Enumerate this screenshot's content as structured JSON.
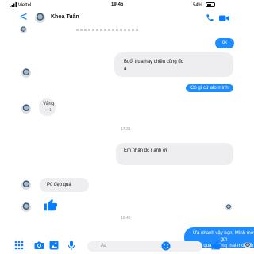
{
  "status": {
    "carrier": "Viettel",
    "time": "19:45",
    "battery": "54%"
  },
  "header": {
    "back": "<",
    "name": "Khoa Tuấn"
  },
  "messages": {
    "ok": "ok ok",
    "buoi_1": "Buổi trưa hay chiều cũng đc",
    "buoi_2": "a",
    "cogi": "Có gì cứ alo mình",
    "vang_1": "Vâng",
    "vang_2": "↩ 1",
    "time_1": "17:31",
    "em": "Em nhận đc r anh ơi",
    "po": "Pô đẹp quá",
    "time_2": "19:45",
    "ua_1": "Ừa nhanh vậy bạn. Mình mới gửi",
    "ua_2": "hôm qua, tưởng mai mới đến kìa"
  },
  "composer": {
    "placeholder": "Aa"
  },
  "icons": {
    "back": "chevron-left-icon",
    "phone": "phone-icon",
    "video": "video-camera-icon",
    "apps": "apps-grid-icon",
    "camera": "camera-icon",
    "gallery": "gallery-icon",
    "mic": "microphone-icon",
    "emoji": "smile-icon",
    "like": "thumbs-up-icon"
  },
  "colors": {
    "accent": "#1e8cff",
    "incoming_bubble": "#eeeef0"
  }
}
